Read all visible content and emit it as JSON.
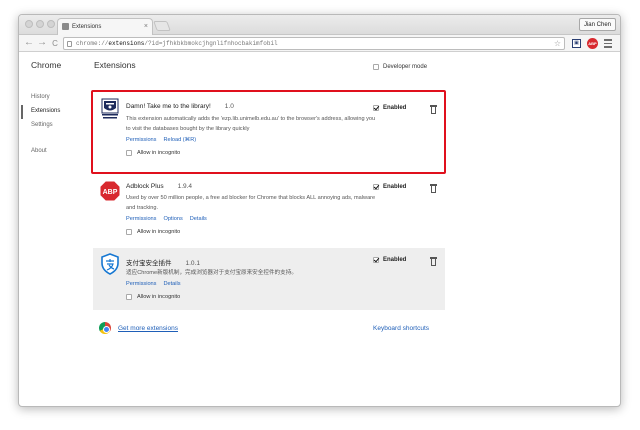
{
  "browser": {
    "tab_title": "Extensions",
    "tab_close": "×",
    "profile_name": "Jian Chen",
    "url_prefix": "chrome://",
    "url_host": "extensions",
    "url_rest": "/?id=jfhkbkbmokcjhgnlifnhocbakimfobil",
    "nav_back": "←",
    "nav_forward": "→",
    "nav_reload": "C",
    "star": "☆"
  },
  "sidebar": {
    "brand": "Chrome",
    "items": [
      {
        "label": "History"
      },
      {
        "label": "Extensions"
      },
      {
        "label": "Settings"
      },
      {
        "label": "About"
      }
    ]
  },
  "main": {
    "heading": "Extensions",
    "developer_mode_label": "Developer mode",
    "extensions": [
      {
        "title": "Damn! Take me to the library!",
        "version": "1.0",
        "description": "This extension automatically adds the 'ezp.lib.unimelb.edu.au' to the browser's address, allowing you to visit the databases bought by the library quickly",
        "links": [
          "Permissions",
          "Reload (⌘R)"
        ],
        "incognito_label": "Allow in incognito",
        "enabled_label": "Enabled",
        "icon": "unimelb-crest-icon"
      },
      {
        "title": "Adblock Plus",
        "version": "1.9.4",
        "description": "Used by over 50 million people, a free ad blocker for Chrome that blocks ALL annoying ads, malware and tracking.",
        "links": [
          "Permissions",
          "Options",
          "Details"
        ],
        "incognito_label": "Allow in incognito",
        "enabled_label": "Enabled",
        "icon": "abp-icon",
        "icon_text": "ABP"
      },
      {
        "title": "支付宝安全插件",
        "version": "1.0.1",
        "description": "适应Chrome新版机制，完成浏览器对于支付宝原来安全控件的支持。",
        "links": [
          "Permissions",
          "Details"
        ],
        "incognito_label": "Allow in incognito",
        "enabled_label": "Enabled",
        "icon": "alipay-shield-icon"
      }
    ],
    "get_more_label": "Get more extensions",
    "keyboard_shortcuts_label": "Keyboard shortcuts"
  },
  "colors": {
    "highlight": "#e0101d",
    "link": "#1f5fb8",
    "abp_red": "#d8292f",
    "alipay_blue": "#1677d2"
  }
}
